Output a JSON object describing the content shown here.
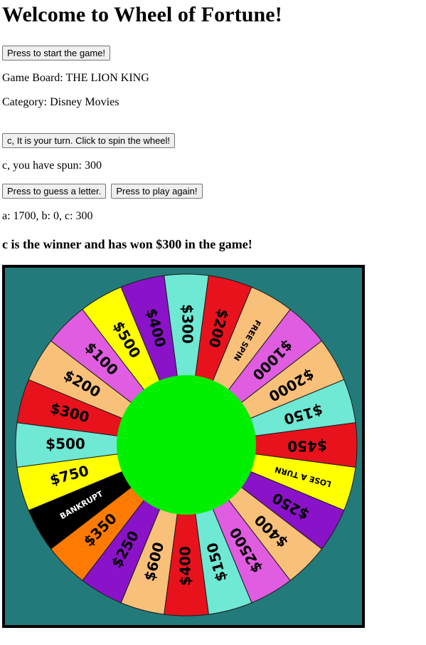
{
  "title": "Welcome to Wheel of Fortune!",
  "start_button": "Press to start the game!",
  "game_board": "Game Board: THE LION KING",
  "category": "Category: Disney Movies",
  "spin_button": "c, It is your turn. Click to spin the wheel!",
  "spun_text": "c, you have spun: 300",
  "guess_button": "Press to guess a letter.",
  "play_again_button": "Press to play again!",
  "scores": "a: 1700, b: 0, c: 300",
  "winner_text": "c is the winner and has won $300 in the game!",
  "wheel": {
    "segments": [
      {
        "label": "$300",
        "color": "#6fe8d4"
      },
      {
        "label": "$200",
        "color": "#e8121c"
      },
      {
        "label": "FREE SPIN",
        "color": "#f9c07a"
      },
      {
        "label": "$1000",
        "color": "#e05ce0"
      },
      {
        "label": "$2000",
        "color": "#f9c07a"
      },
      {
        "label": "$150",
        "color": "#6fe8d4"
      },
      {
        "label": "$450",
        "color": "#e8121c"
      },
      {
        "label": "LOSE A TURN",
        "color": "#ffff00"
      },
      {
        "label": "$250",
        "color": "#8a12c8"
      },
      {
        "label": "$400",
        "color": "#f9c07a"
      },
      {
        "label": "$2500",
        "color": "#e05ce0"
      },
      {
        "label": "$150",
        "color": "#6fe8d4"
      },
      {
        "label": "$400",
        "color": "#e8121c"
      },
      {
        "label": "$600",
        "color": "#f9c07a"
      },
      {
        "label": "$250",
        "color": "#8a12c8"
      },
      {
        "label": "$350",
        "color": "#ff7a00"
      },
      {
        "label": "BANKRUPT",
        "color": "#000000"
      },
      {
        "label": "$750",
        "color": "#ffff00"
      },
      {
        "label": "$500",
        "color": "#6fe8d4"
      },
      {
        "label": "$300",
        "color": "#e8121c"
      },
      {
        "label": "$200",
        "color": "#f9c07a"
      },
      {
        "label": "$100",
        "color": "#e05ce0"
      },
      {
        "label": "$500",
        "color": "#ffff00"
      },
      {
        "label": "$400",
        "color": "#8a12c8"
      }
    ],
    "hub_color": "#00f000",
    "background_color": "#237a7a"
  }
}
